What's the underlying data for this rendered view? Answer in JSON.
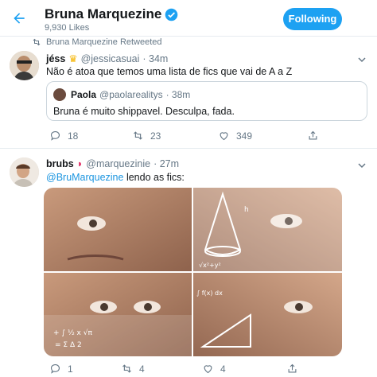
{
  "header": {
    "profile_name": "Bruna Marquezine",
    "likes": "9,930 Likes",
    "follow_label": "Following"
  },
  "retweet_bar": {
    "text": "Bruna Marquezine Retweeted"
  },
  "tweets": [
    {
      "name": "jéss",
      "handle": "@jessicasuai",
      "time": "· 34m",
      "text": "Não é atoa que temos uma lista de fics que vai de A a Z",
      "quote": {
        "name": "Paola",
        "handle": "@paolarealitys",
        "time": "· 38m",
        "text": "Bruna é muito shippavel. Desculpa, fada."
      },
      "replies": "18",
      "retweets": "23",
      "likes": "349"
    },
    {
      "name": "brubs",
      "handle": "@marquezinie",
      "time": "· 27m",
      "mention": "@BruMarquezine",
      "text": " lendo as fics:",
      "replies": "1",
      "retweets": "4",
      "likes": "4"
    }
  ],
  "colors": {
    "accent": "#1da1f2",
    "text_secondary": "#657786",
    "link": "#1b95e0"
  }
}
